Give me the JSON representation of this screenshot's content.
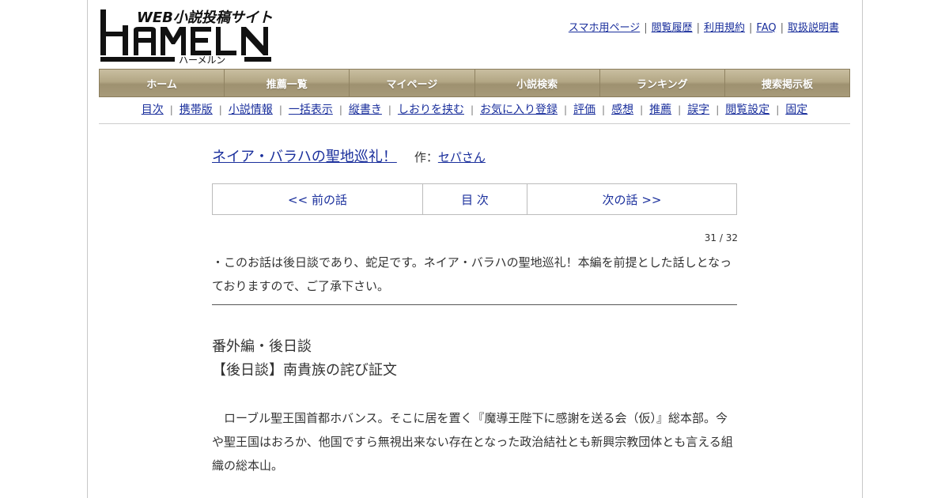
{
  "header": {
    "logo": {
      "tagline": "WEB小説投稿サイト",
      "wordmark": "HAMELN",
      "reading": "ハーメルン"
    },
    "top_links": [
      "スマホ用ページ",
      "閲覧履歴",
      "利用規約",
      "FAQ",
      "取扱説明書"
    ]
  },
  "global_nav": [
    "ホーム",
    "推薦一覧",
    "マイページ",
    "小説検索",
    "ランキング",
    "捜索掲示板"
  ],
  "sub_nav": [
    "目次",
    "携帯版",
    "小説情報",
    "一括表示",
    "縦書き",
    "しおりを挟む",
    "お気に入り登録",
    "評価",
    "感想",
    "推薦",
    "誤字",
    "閲覧設定",
    "固定"
  ],
  "novel": {
    "title": "ネイア・バラハの聖地巡礼！",
    "author_label": "作：",
    "author": "セパさん"
  },
  "pager": {
    "prev": "<< 前の話",
    "toc": "目 次",
    "next": "次の話 >>"
  },
  "episode": {
    "count": "31 / 32",
    "notice": "・このお話は後日談であり、蛇足です。ネイア・バラハの聖地巡礼！本編を前提とした話しとなっておりますので、ご了承下さい。",
    "subtitle_line1": "番外編・後日談",
    "subtitle_line2": "【後日談】南貴族の詫び証文",
    "body": "　ローブル聖王国首都ホバンス。そこに居を置く『魔導王陛下に感謝を送る会（仮）』総本部。今や聖王国はおろか、他国ですら無視出来ない存在となった政治結社とも新興宗教団体とも言える組織の総本山。"
  },
  "colors": {
    "link": "#1a2f9c",
    "nav_bg": "#b3a785",
    "nav_text": "#ffffff",
    "text": "#333333"
  }
}
